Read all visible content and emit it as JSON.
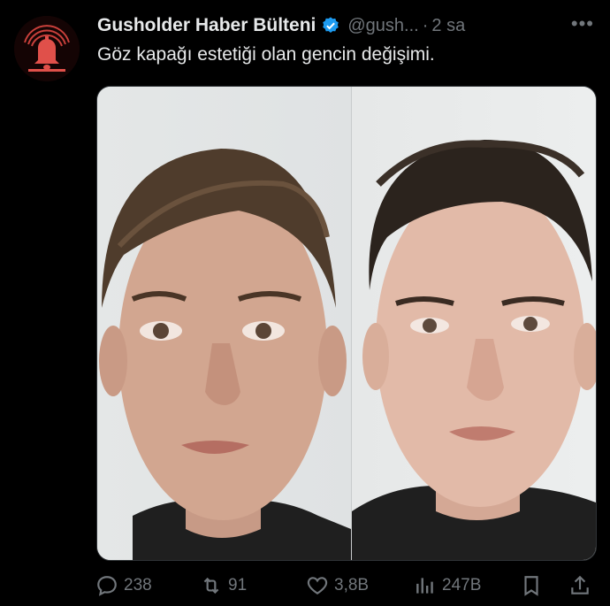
{
  "post": {
    "author_name": "Gusholder Haber Bülteni",
    "handle": "@gush...",
    "separator": "·",
    "time": "2 sa",
    "more": "•••",
    "text": "Göz kapağı estetiği olan gencin değişimi."
  },
  "avatar": {
    "icon": "bell-icon",
    "color": "#e0504a"
  },
  "media": {
    "type": "before-after-photo"
  },
  "actions": {
    "replies": "238",
    "reposts": "91",
    "likes": "3,8B",
    "views": "247B"
  },
  "colors": {
    "background": "#000000",
    "text": "#e7e9ea",
    "muted": "#71767b",
    "verified": "#1d9bf0"
  }
}
